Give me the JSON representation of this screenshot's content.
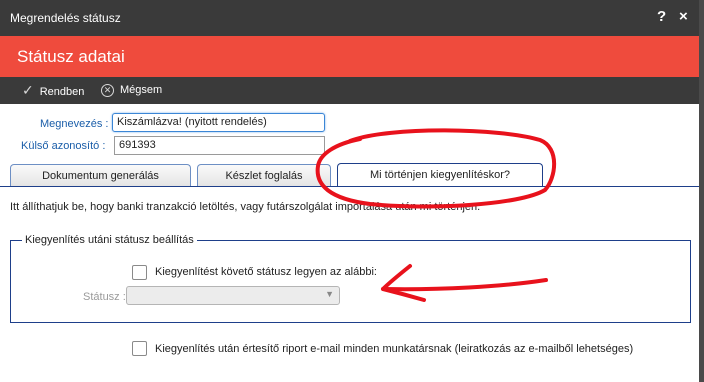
{
  "window": {
    "title": "Megrendelés státusz",
    "help": "?",
    "close": "×"
  },
  "header": {
    "title": "Státusz adatai"
  },
  "toolbar": {
    "ok_label": "Rendben",
    "cancel_label": "Mégsem"
  },
  "form": {
    "name_label": "Megnevezés :",
    "name_value": "Kiszámlázva! (nyitott rendelés)",
    "extid_label": "Külső azonosító :",
    "extid_value": "691393"
  },
  "tabs": [
    {
      "label": "Dokumentum generálás",
      "active": false
    },
    {
      "label": "Készlet foglalás",
      "active": false
    },
    {
      "label": "Mi történjen kiegyenlítéskor?",
      "active": true
    }
  ],
  "panel": {
    "description": "Itt állíthatjuk be, hogy banki tranzakció letöltés, vagy futárszolgálat importálása után mi történjen.",
    "fieldset_legend": "Kiegyenlítés utáni státusz beállítás",
    "follow_status_label": "Kiegyenlítést követő státusz legyen az alábbi:",
    "follow_status_checked": false,
    "status_label": "Státusz :",
    "status_value": "",
    "notify_label": "Kiegyenlítés után értesítő riport e-mail minden munkatársnak (leiratkozás az e-mailből lehetséges)",
    "notify_checked": false
  },
  "colors": {
    "header": "#ef4b3d",
    "titlebar": "#3a3a3a",
    "tab_border": "#1e3f8a",
    "label_blue": "#1b5ea9",
    "annotation": "#e8121c"
  },
  "icons": {
    "ok": "checkmark-icon",
    "cancel": "close-circle-icon",
    "help": "help-icon",
    "close": "close-icon",
    "dropdown": "chevron-down-icon"
  }
}
